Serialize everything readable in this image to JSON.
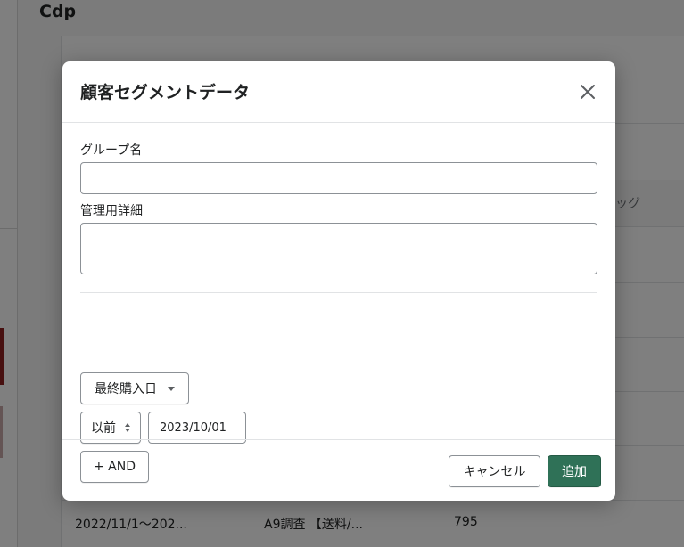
{
  "background": {
    "page_title": "Cdp",
    "column_tail": "ッグ",
    "row": {
      "period": "2022/11/1〜202...",
      "name": "A9調査 【送料/...",
      "count": "795"
    }
  },
  "modal": {
    "title": "顧客セグメントデータ",
    "group_name_label": "グループ名",
    "group_name_value": "",
    "admin_detail_label": "管理用詳細",
    "admin_detail_value": "",
    "condition_field": "最終購入日",
    "operator": "以前",
    "date_value": "2023/10/01",
    "and_label": "+ AND",
    "cancel_label": "キャンセル",
    "add_label": "追加"
  },
  "colors": {
    "primary": "#2f7157",
    "overlay": "rgba(0,0,0,0.5)"
  },
  "icons": {
    "close": "close-icon",
    "dropdown": "caret-down-icon",
    "select": "select-updown-icon"
  }
}
